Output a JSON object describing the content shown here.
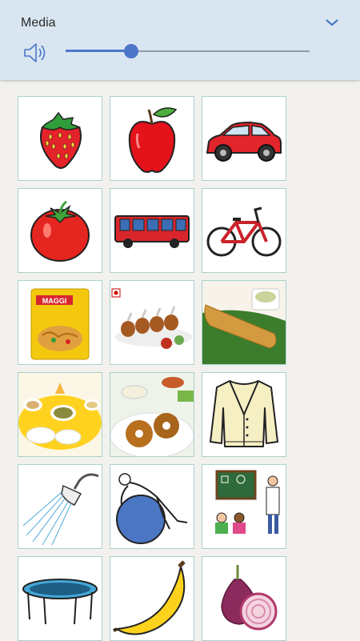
{
  "media": {
    "title": "Media",
    "chevron_icon": "chevron-down-icon",
    "speaker_icon": "volume-icon",
    "volume_level": 0.27,
    "accent_color": "#4c76c8",
    "panel_color": "#d9e6f1"
  },
  "tiles": [
    {
      "icon": "strawberry"
    },
    {
      "icon": "apple"
    },
    {
      "icon": "car"
    },
    {
      "icon": "tomato"
    },
    {
      "icon": "bus"
    },
    {
      "icon": "bicycle"
    },
    {
      "icon": "noodles-packet"
    },
    {
      "icon": "chicken-lollipop"
    },
    {
      "icon": "dosa"
    },
    {
      "icon": "idli"
    },
    {
      "icon": "vada"
    },
    {
      "icon": "cardigan"
    },
    {
      "icon": "shower"
    },
    {
      "icon": "exercise-ball"
    },
    {
      "icon": "classroom"
    },
    {
      "icon": "trampoline"
    },
    {
      "icon": "banana"
    },
    {
      "icon": "onion"
    }
  ]
}
